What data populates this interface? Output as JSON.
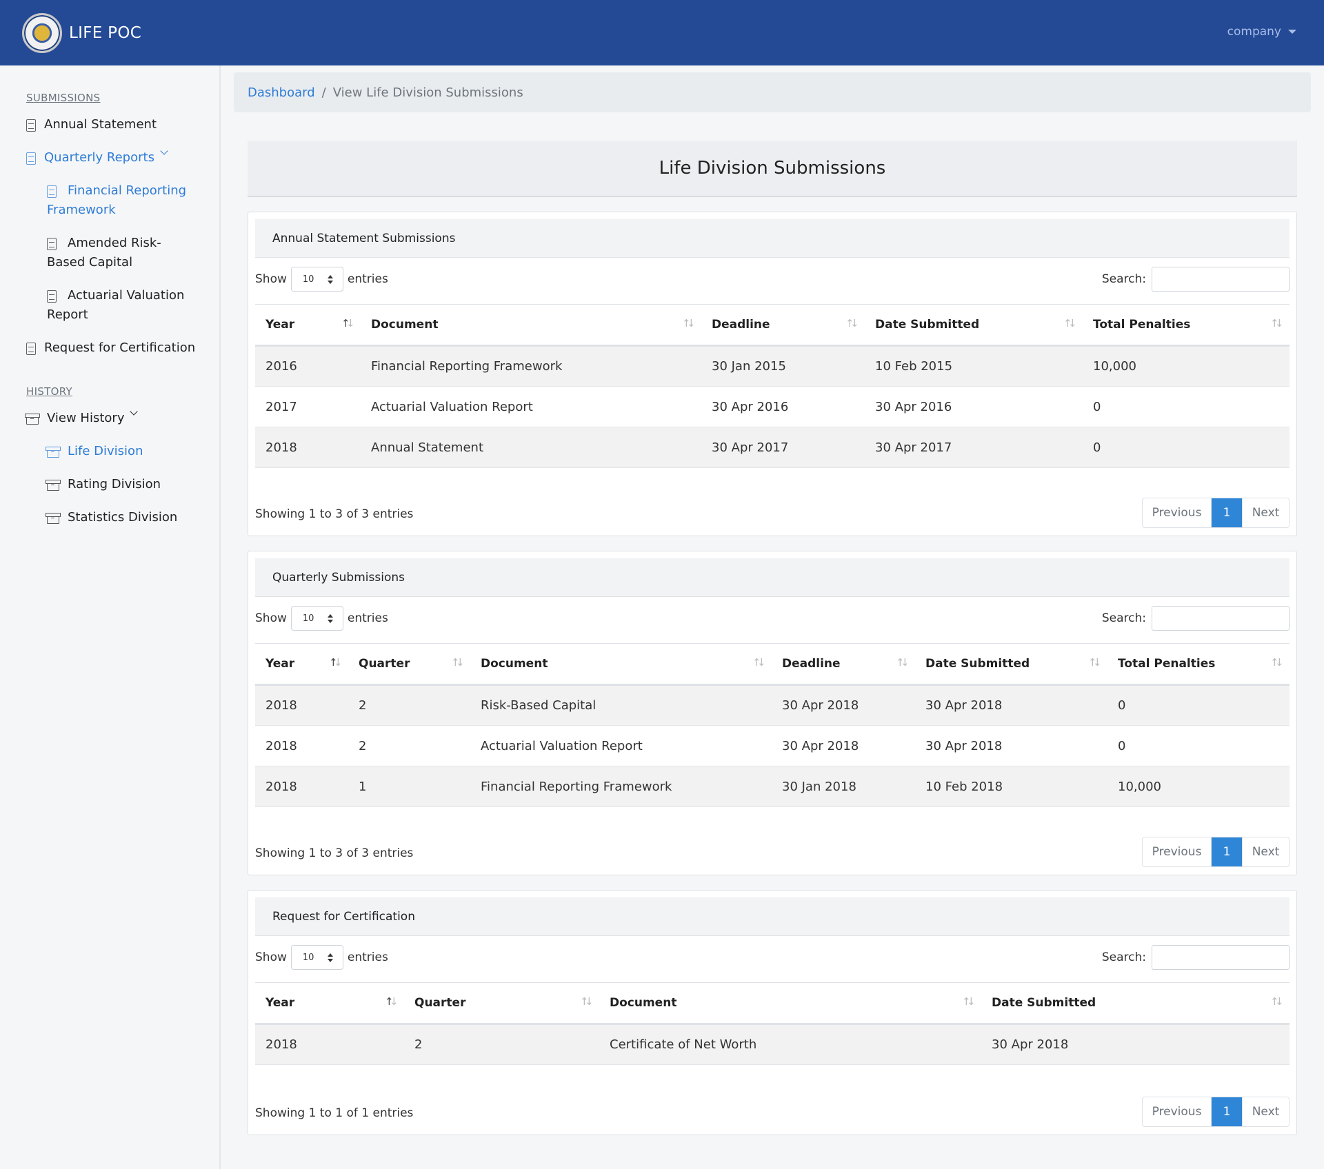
{
  "navbar": {
    "brand": "LIFE POC",
    "user_menu": "company"
  },
  "sidebar": {
    "submissions_title": "SUBMISSIONS",
    "history_title": "HISTORY",
    "annual_statement": "Annual Statement",
    "quarterly_reports": "Quarterly Reports",
    "financial_reporting_framework": "Financial Reporting Framework",
    "amended_rbc": "Amended Risk-Based Capital",
    "actuarial_valuation_report": "Actuarial Valuation Report",
    "request_for_certification": "Request for Certification",
    "view_history": "View History",
    "life_division": "Life Division",
    "rating_division": "Rating Division",
    "statistics_division": "Statistics Division"
  },
  "breadcrumb": {
    "home": "Dashboard",
    "sep": "/",
    "current": "View Life Division Submissions"
  },
  "page_title": "Life Division Submissions",
  "common": {
    "show": "Show",
    "entries": "entries",
    "length": "10",
    "search_label": "Search:",
    "previous": "Previous",
    "page": "1",
    "next": "Next"
  },
  "annual": {
    "title": "Annual Statement Submissions",
    "headers": [
      "Year",
      "Document",
      "Deadline",
      "Date Submitted",
      "Total Penalties"
    ],
    "rows": [
      [
        "2016",
        "Financial Reporting Framework",
        "30 Jan 2015",
        "10 Feb 2015",
        "10,000"
      ],
      [
        "2017",
        "Actuarial Valuation Report",
        "30 Apr 2016",
        "30 Apr 2016",
        "0"
      ],
      [
        "2018",
        "Annual Statement",
        "30 Apr 2017",
        "30 Apr 2017",
        "0"
      ]
    ],
    "info": "Showing 1 to 3 of 3 entries"
  },
  "quarterly": {
    "title": "Quarterly Submissions",
    "headers": [
      "Year",
      "Quarter",
      "Document",
      "Deadline",
      "Date Submitted",
      "Total Penalties"
    ],
    "rows": [
      [
        "2018",
        "2",
        "Risk-Based Capital",
        "30 Apr 2018",
        "30 Apr 2018",
        "0"
      ],
      [
        "2018",
        "2",
        "Actuarial Valuation Report",
        "30 Apr 2018",
        "30 Apr 2018",
        "0"
      ],
      [
        "2018",
        "1",
        "Financial Reporting Framework",
        "30 Jan 2018",
        "10 Feb 2018",
        "10,000"
      ]
    ],
    "info": "Showing 1 to 3 of 3 entries"
  },
  "certification": {
    "title": "Request for Certification",
    "headers": [
      "Year",
      "Quarter",
      "Document",
      "Date Submitted"
    ],
    "rows": [
      [
        "2018",
        "2",
        "Certificate of Net Worth",
        "30 Apr 2018"
      ]
    ],
    "info": "Showing 1 to 1 of 1 entries"
  }
}
